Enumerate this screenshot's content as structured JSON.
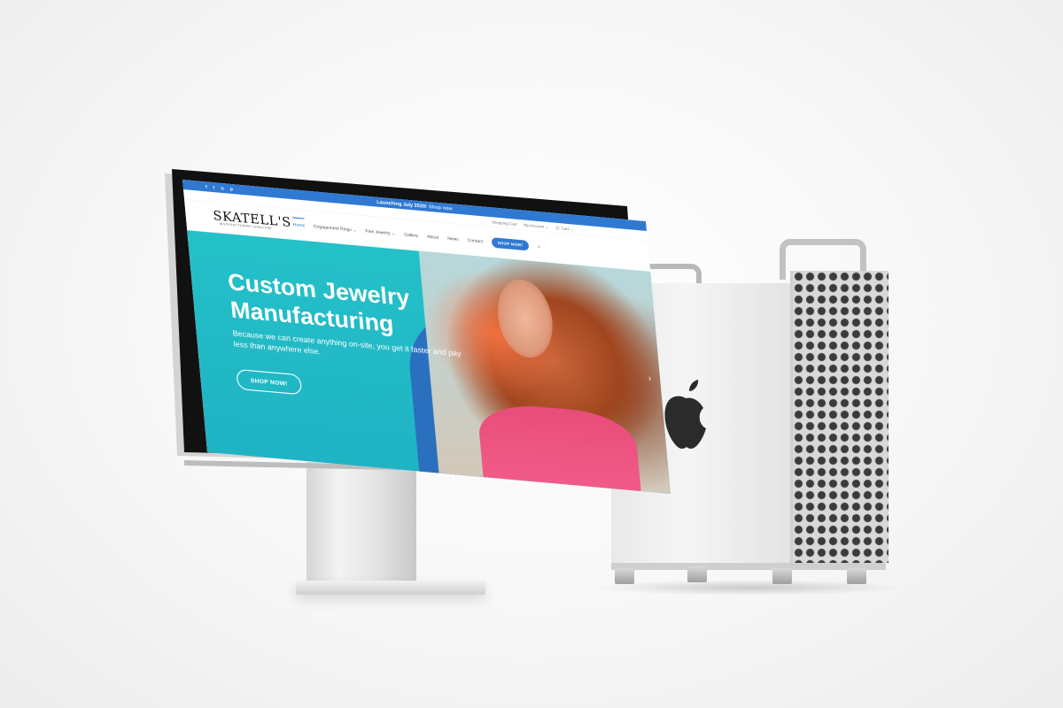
{
  "site": {
    "announcement": {
      "text": "Launching July 2020!",
      "cta": "Shop now"
    },
    "social_icons": [
      "facebook-icon",
      "twitter-icon",
      "instagram-icon",
      "pinterest-icon"
    ],
    "utility": {
      "shopping_cart": "Shopping Cart",
      "my_account": "My Account",
      "cart": "Cart"
    },
    "logo": {
      "main": "SKATELL'S",
      "sub": "MANUFACTURING JEWELERS"
    },
    "nav": {
      "items": [
        "Home",
        "Engagement Rings",
        "Fine Jewelry",
        "Gallery",
        "About",
        "News",
        "Contact"
      ],
      "shop_button": "SHOP NOW!"
    },
    "hero": {
      "title_line1": "Custom Jewelry",
      "title_line2": "Manufacturing",
      "subtitle": "Because we can create anything on-site, you get it faster and pay less than anywhere else.",
      "button": "SHOP NOW!"
    },
    "colors": {
      "accent": "#2f79d3",
      "hero_bg": "#24c1c9",
      "hero_shape": "#2c6bbf"
    }
  }
}
